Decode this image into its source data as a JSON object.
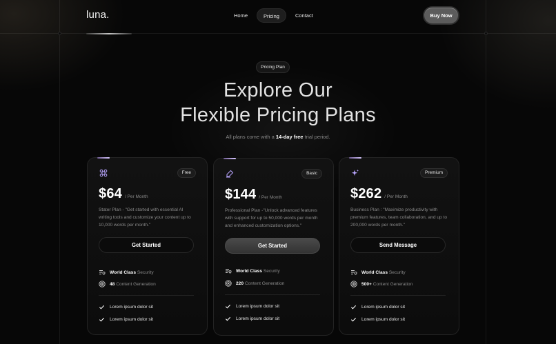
{
  "brand": {
    "logo": "luna."
  },
  "nav": {
    "items": [
      {
        "label": "Home",
        "active": false
      },
      {
        "label": "Pricing",
        "active": true
      },
      {
        "label": "Contact",
        "active": false
      }
    ],
    "buy_label": "Buy Now"
  },
  "hero": {
    "badge": "Pricing Plan",
    "title_line1": "Explore Our",
    "title_line2": "Flexible Pricing Plans",
    "sub_prefix": "All plans come with a ",
    "sub_bold": "14-day free",
    "sub_suffix": " trial period."
  },
  "plans": [
    {
      "icon": "command-icon",
      "tag": "Free",
      "price": "$64",
      "period": "/ Per Month",
      "description": "Stater Plan - \"Get started with essential AI writing tools and customize your content up to 10,000 words per month.\"",
      "cta": "Get Started",
      "cta_primary": false,
      "feature1_bold": "World Class",
      "feature1_text": "Security",
      "feature2_bold": "48",
      "feature2_text": "Content Generation",
      "checks": [
        "Lorem ipsum dolor sit",
        "Lorem ipsum dolor sit"
      ]
    },
    {
      "icon": "pen-icon",
      "tag": "Basic",
      "price": "$144",
      "period": "/ Per Month",
      "description": "Professional Plan -\"Unlock advanced features with support for up to 50,000 words per month and enhanced customization options.\"",
      "cta": "Get Started",
      "cta_primary": true,
      "feature1_bold": "World Class",
      "feature1_text": "Security",
      "feature2_bold": "220",
      "feature2_text": "Content Generation",
      "checks": [
        "Lorem ipsum dolor sit",
        "Lorem ipsum dolor sit"
      ]
    },
    {
      "icon": "sparkle-icon",
      "tag": "Premium",
      "price": "$262",
      "period": "/ Per Month",
      "description": "Business Plan : \"Maximize productivity with premium features, team collaboration, and up to 200,000 words per month.\"",
      "cta": "Send Message",
      "cta_primary": false,
      "feature1_bold": "World Class",
      "feature1_text": "Security",
      "feature2_bold": "500+",
      "feature2_text": "Content Generation",
      "checks": [
        "Lorem ipsum dolor sit",
        "Lorem ipsum dolor sit"
      ]
    }
  ],
  "colors": {
    "accent_purple": "#b9a6ff",
    "background": "#070707",
    "card": "#111111"
  }
}
